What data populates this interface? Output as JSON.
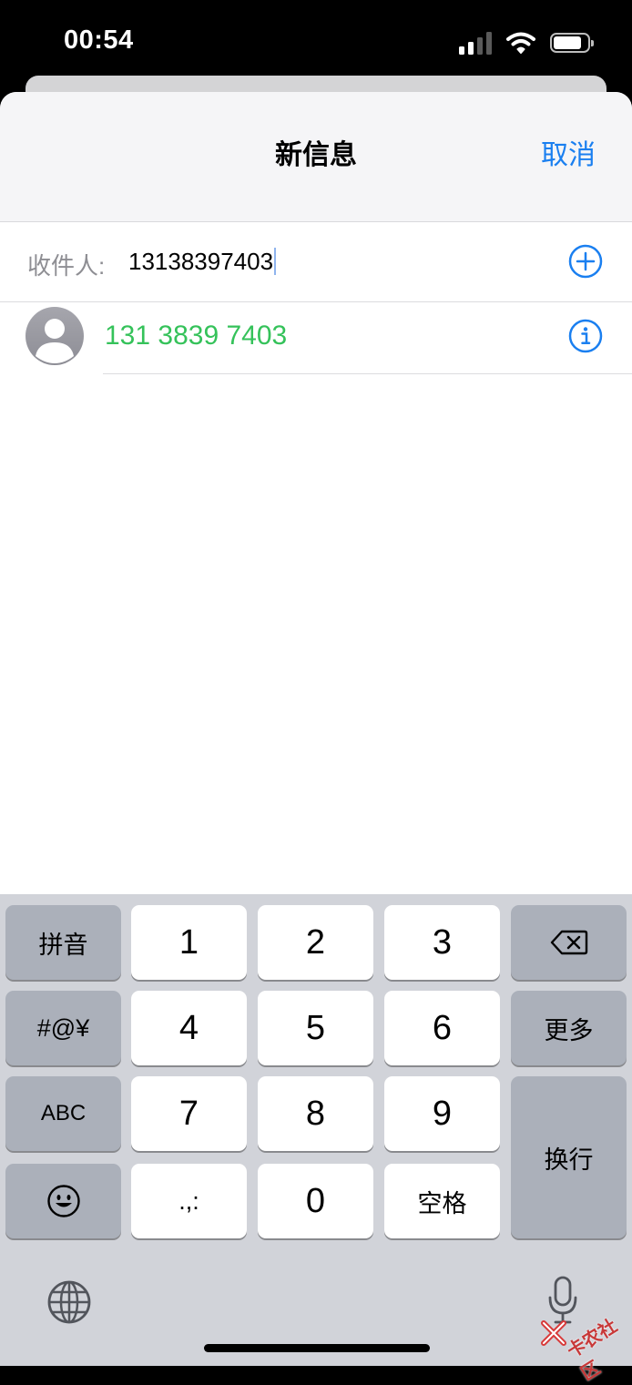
{
  "status_bar": {
    "time": "00:54"
  },
  "header": {
    "title": "新信息",
    "cancel_label": "取消"
  },
  "recipient": {
    "label": "收件人:",
    "value": "13138397403"
  },
  "suggestion": {
    "number": "131 3839 7403"
  },
  "keyboard": {
    "keys": {
      "pinyin": "拼音",
      "k1": "1",
      "k2": "2",
      "k3": "3",
      "symbols": "#@¥",
      "k4": "4",
      "k5": "5",
      "k6": "6",
      "more": "更多",
      "abc": "ABC",
      "k7": "7",
      "k8": "8",
      "k9": "9",
      "return": "换行",
      "punct": ".,:",
      "k0": "0",
      "space": "空格"
    }
  },
  "watermark": {
    "text": "卡农社区"
  },
  "colors": {
    "accent": "#1a7ff0",
    "suggestion_green": "#35c25a",
    "keyboard_bg": "#d1d3d9"
  }
}
